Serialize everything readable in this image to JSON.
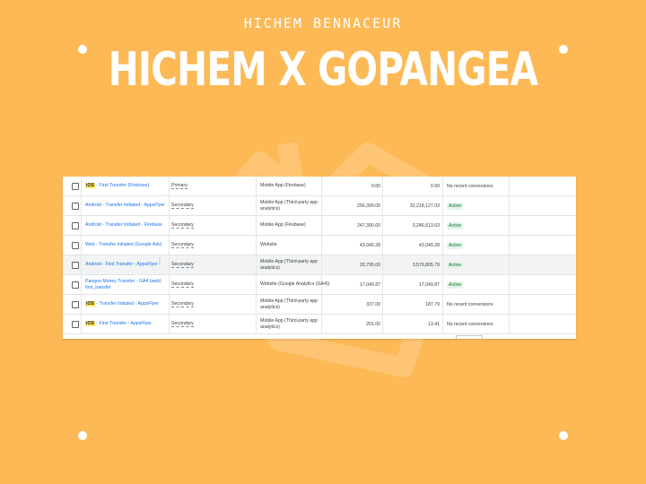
{
  "header": {
    "author": "HICHEM BENNACEUR",
    "title": "HICHEM X GOPANGEA"
  },
  "colors": {
    "background": "#FDB955",
    "link": "#1a73e8",
    "active_badge_bg": "#e6f4ea",
    "active_badge_text": "#137333",
    "highlight": "#f9e65a"
  },
  "table": {
    "rows": [
      {
        "ios": "iOS",
        "name": " - First Transfer (Firebase)",
        "type": "Primary",
        "source": "Mobile App (Firebase)",
        "value1": "0.00",
        "value2": "0.00",
        "status": "No recent conversions",
        "active": false,
        "highlighted": false
      },
      {
        "ios": "",
        "name": "Android - Transfer Initiated - AppsFlyer",
        "type": "Secondary",
        "source": "Mobile App (Third-party app analytics)",
        "value1": "256,399.00",
        "value2": "32,218,127.03",
        "status": "Active",
        "active": true,
        "highlighted": false
      },
      {
        "ios": "",
        "name": "Android - Transfer Initiated - Firebase",
        "type": "Secondary",
        "source": "Mobile App (Firebase)",
        "value1": "247,390.00",
        "value2": "3,246,513.63",
        "status": "Active",
        "active": true,
        "highlighted": false
      },
      {
        "ios": "",
        "name": "Web - Transfer Initiated (Google Ads)",
        "type": "Secondary",
        "source": "Website",
        "value1": "43,049.28",
        "value2": "43,049.28",
        "status": "Active",
        "active": true,
        "highlighted": false
      },
      {
        "ios": "",
        "name": "Android - First Transfer - AppsFlyer",
        "type": "Secondary",
        "source": "Mobile App (Third-party app analytics)",
        "value1": "20,795.00",
        "value2": "3,579,805.79",
        "status": "Active",
        "active": true,
        "highlighted": true
      },
      {
        "ios": "",
        "name": "Pangea Money Transfer - GA4 (web) first_transfer",
        "type": "Secondary",
        "source": "Website (Google Analytics (GA4))",
        "value1": "17,049.87",
        "value2": "17,049.87",
        "status": "Active",
        "active": true,
        "highlighted": false
      },
      {
        "ios": "iOS",
        "name": " - Transfer Initiated - AppsFlyer",
        "type": "Secondary",
        "source": "Mobile App (Third-party app analytics)",
        "value1": "337.00",
        "value2": "187.79",
        "status": "No recent conversions",
        "active": false,
        "highlighted": false
      },
      {
        "ios": "iOS",
        "name": " - First Transfer - AppsFlyer",
        "type": "Secondary",
        "source": "Mobile App (Third-party app analytics)",
        "value1": "201.00",
        "value2": "13.41",
        "status": "No recent conversions",
        "active": false,
        "highlighted": false
      }
    ]
  }
}
